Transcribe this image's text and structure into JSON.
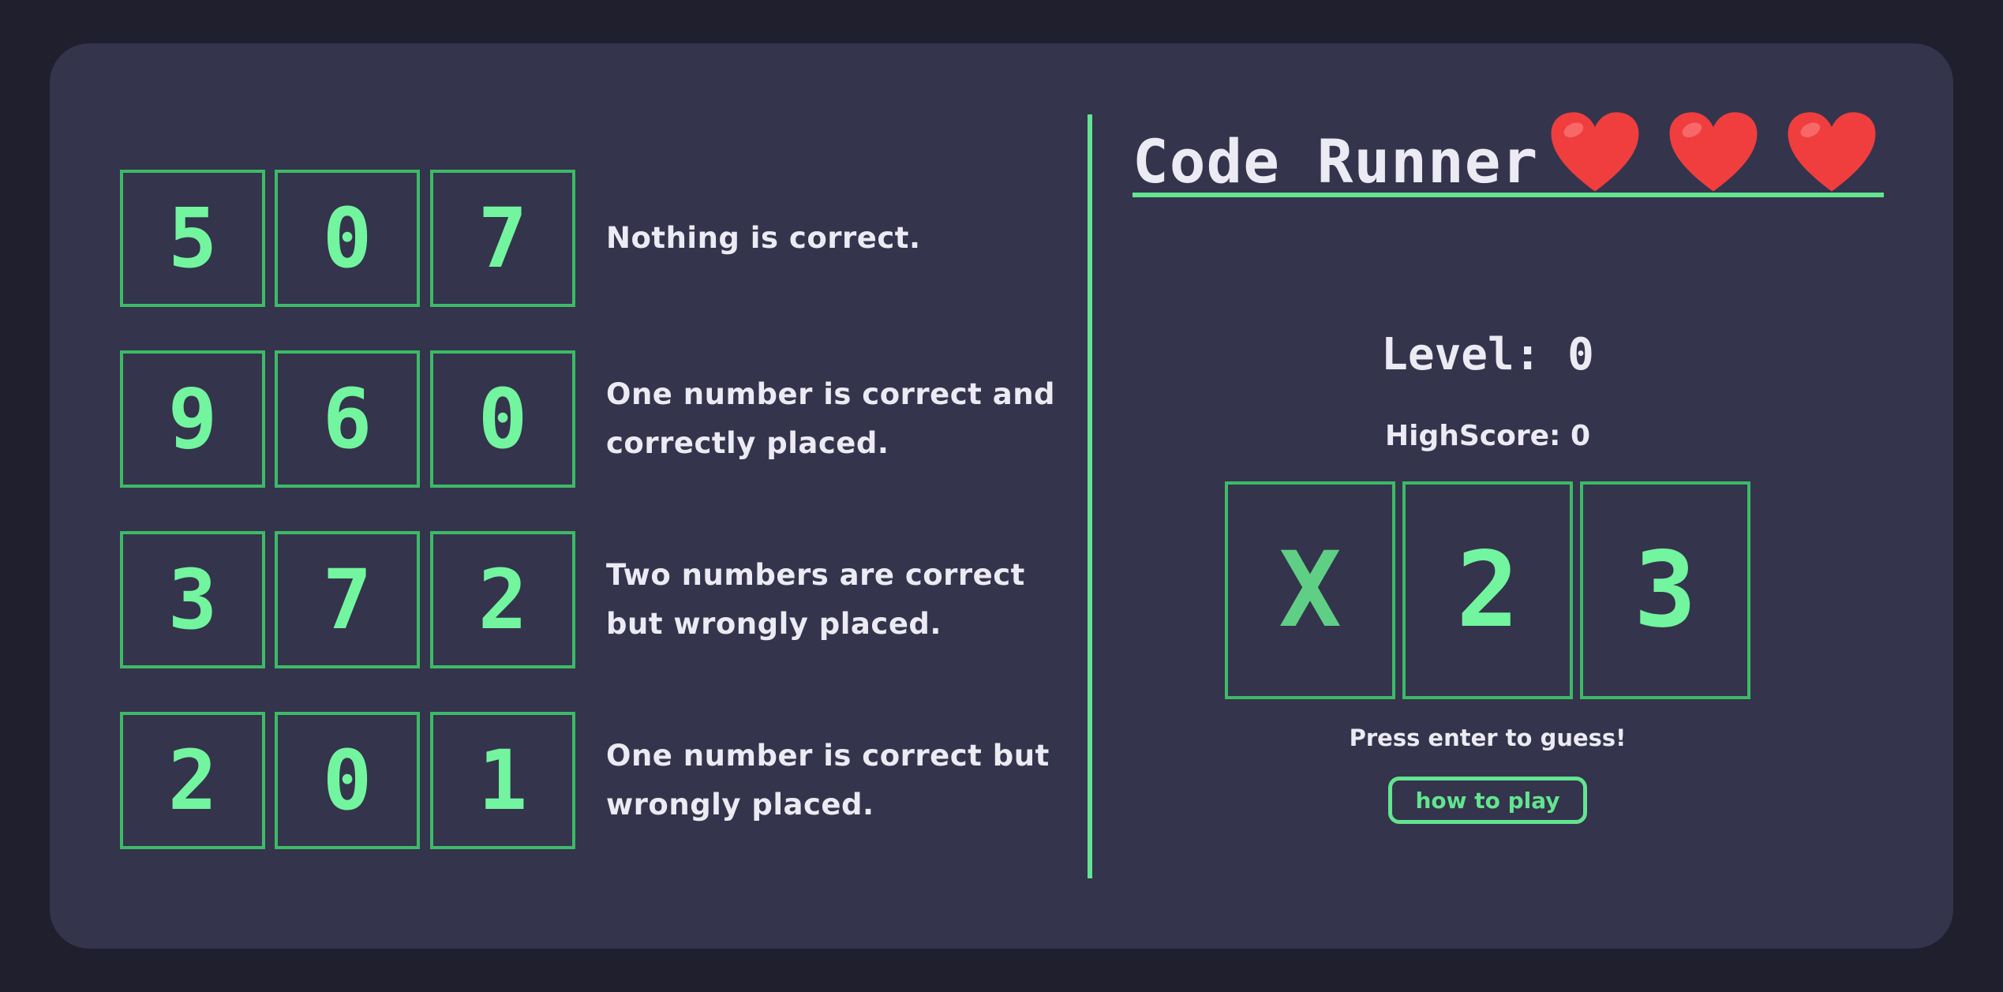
{
  "game": {
    "title": "Code Runner",
    "lives": 3,
    "level_text": "Level: 0",
    "highscore_text": "HighScore: 0",
    "guess": [
      "X",
      "2",
      "3"
    ],
    "press_enter_text": "Press enter to guess!",
    "how_to_play_label": "how to play"
  },
  "hints": [
    {
      "digits": [
        "5",
        "0",
        "7"
      ],
      "text": "Nothing is correct."
    },
    {
      "digits": [
        "9",
        "6",
        "0"
      ],
      "text": "One number is correct and correctly placed."
    },
    {
      "digits": [
        "3",
        "7",
        "2"
      ],
      "text": "Two numbers are correct but wrongly placed."
    },
    {
      "digits": [
        "2",
        "0",
        "1"
      ],
      "text": "One number is correct but wrongly placed."
    }
  ],
  "icons": {
    "life": "heart-icon"
  },
  "colors": {
    "background": "#1f1f2e",
    "panel": "#34344d",
    "accent": "#63e48f",
    "digit": "#72f59e",
    "box_border": "#3dba66",
    "text": "#eceaf2",
    "heart": "#f03e3e"
  }
}
